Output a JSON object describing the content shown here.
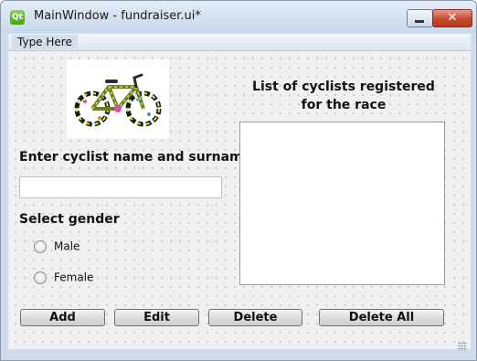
{
  "window": {
    "title": "MainWindow - fundraiser.ui*",
    "close_glyph": "✕"
  },
  "menubar": {
    "items": [
      {
        "label": "Type Here"
      }
    ]
  },
  "form": {
    "name_heading": "Enter cyclist name and surname",
    "name_input_value": "",
    "gender_heading": "Select gender",
    "gender_options": [
      {
        "label": "Male",
        "selected": false
      },
      {
        "label": "Female",
        "selected": false
      }
    ],
    "list_heading": "List of cyclists registered for the race",
    "cyclists": []
  },
  "buttons": {
    "add": "Add",
    "edit": "Edit",
    "delete": "Delete",
    "delete_all": "Delete All"
  },
  "icons": {
    "app": "qt-designer-icon",
    "image": "bicycle-image"
  },
  "colors": {
    "close_button": "#c54a32",
    "designer_grid_dot": "#b0b0b0",
    "window_frame": "#cfdcec"
  }
}
